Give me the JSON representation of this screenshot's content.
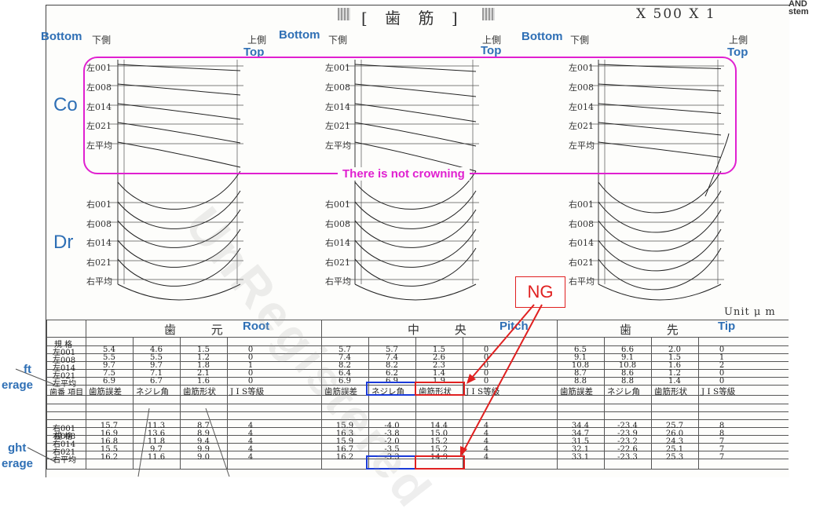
{
  "header": {
    "title": "[ 歯 筋 ]",
    "scale": "X 500  X 1",
    "top_right": [
      "AND",
      "stem"
    ]
  },
  "columns": [
    {
      "bottom_en": "Bottom",
      "bottom_jp": "下側",
      "top_jp": "上側",
      "top_en": "Top"
    },
    {
      "bottom_en": "Bottom",
      "bottom_jp": "下側",
      "top_jp": "上側",
      "top_en": "Top"
    },
    {
      "bottom_en": "Bottom",
      "bottom_jp": "下側",
      "top_jp": "上側",
      "top_en": "Top"
    }
  ],
  "side_labels": {
    "left_flank": "Co",
    "right_flank": "Dr"
  },
  "trace_labels": {
    "left": [
      "左001",
      "左008",
      "左014",
      "左021",
      "左平均"
    ],
    "right": [
      "右001",
      "右008",
      "右014",
      "右021",
      "右平均"
    ]
  },
  "annotation": {
    "crowning": "There is not crowning",
    "ng": "NG"
  },
  "unit": "Unit  μ m",
  "watermark": "UnRegistered",
  "table": {
    "sections": [
      {
        "jp": "歯 元",
        "en": "Root"
      },
      {
        "jp": "中 央",
        "en": "Pitch"
      },
      {
        "jp": "歯 先",
        "en": "Tip"
      }
    ],
    "spec_label": "規 格",
    "item_label": "歯番 項目",
    "headers": [
      "歯筋誤差",
      "ネジレ角",
      "歯筋形状",
      "J I S等級"
    ],
    "left_rows": [
      {
        "label": "左001",
        "values": [
          [
            "5.4",
            "4.6",
            "1.5",
            "0"
          ],
          [
            "5.7",
            "5.7",
            "1.5",
            "0"
          ],
          [
            "6.5",
            "6.6",
            "2.0",
            "0"
          ]
        ]
      },
      {
        "label": "左008",
        "values": [
          [
            "5.5",
            "5.5",
            "1.2",
            "0"
          ],
          [
            "7.4",
            "7.4",
            "2.6",
            "0"
          ],
          [
            "9.1",
            "9.1",
            "1.5",
            "1"
          ]
        ]
      },
      {
        "label": "左014",
        "values": [
          [
            "9.7",
            "9.7",
            "1.8",
            "1"
          ],
          [
            "8.2",
            "8.2",
            "2.3",
            "0"
          ],
          [
            "10.8",
            "10.8",
            "1.6",
            "2"
          ]
        ]
      },
      {
        "label": "左021",
        "values": [
          [
            "7.5",
            "7.1",
            "2.1",
            "0"
          ],
          [
            "6.4",
            "6.2",
            "1.4",
            "0"
          ],
          [
            "8.7",
            "8.6",
            "1.2",
            "0"
          ]
        ]
      },
      {
        "label": "左平均",
        "values": [
          [
            "6.9",
            "6.7",
            "1.6",
            "0"
          ],
          [
            "6.9",
            "6.9",
            "1.9",
            "0"
          ],
          [
            "8.8",
            "8.8",
            "1.4",
            "0"
          ]
        ]
      }
    ],
    "right_rows": [
      {
        "label": "右001",
        "values": [
          [
            "15.7",
            "11.3",
            "8.7",
            "4"
          ],
          [
            "15.9",
            "-4.0",
            "14.4",
            "4"
          ],
          [
            "34.4",
            "-23.4",
            "25.7",
            "8"
          ]
        ]
      },
      {
        "label": "右008",
        "values": [
          [
            "16.9",
            "13.6",
            "8.9",
            "4"
          ],
          [
            "16.3",
            "-3.8",
            "15.0",
            "4"
          ],
          [
            "34.7",
            "-23.9",
            "26.0",
            "8"
          ]
        ]
      },
      {
        "label": "右014",
        "values": [
          [
            "16.8",
            "11.8",
            "9.4",
            "4"
          ],
          [
            "15.9",
            "-2.0",
            "15.2",
            "4"
          ],
          [
            "31.5",
            "-23.2",
            "24.3",
            "7"
          ]
        ]
      },
      {
        "label": "右021",
        "values": [
          [
            "15.5",
            "9.7",
            "9.9",
            "4"
          ],
          [
            "16.7",
            "-3.5",
            "15.2",
            "4"
          ],
          [
            "32.1",
            "-22.6",
            "25.1",
            "7"
          ]
        ]
      },
      {
        "label": "右平均",
        "values": [
          [
            "16.2",
            "11.6",
            "9.0",
            "4"
          ],
          [
            "16.2",
            "-3.3",
            "14.9",
            "4"
          ],
          [
            "33.1",
            "-23.3",
            "25.3",
            "7"
          ]
        ]
      }
    ]
  },
  "left_margin_labels": {
    "left_avg": [
      "ft",
      "erage"
    ],
    "right_avg": [
      "ght",
      "erage"
    ]
  },
  "colors": {
    "accent_blue": "#2e6fb5",
    "magenta": "#e020d0",
    "ng_red": "#e02020",
    "box_blue": "#1a3ad8"
  }
}
